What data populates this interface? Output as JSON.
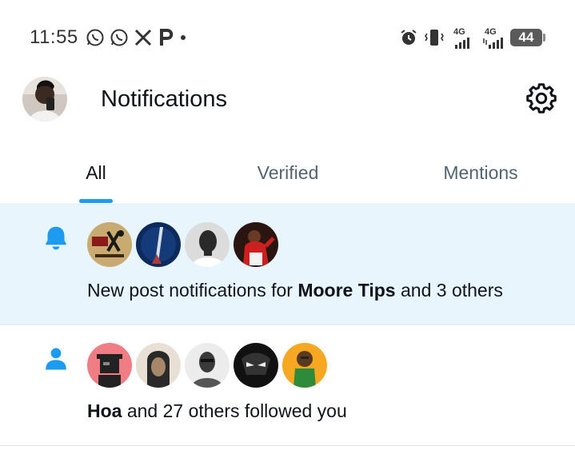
{
  "status_bar": {
    "time": "11:55",
    "battery": "44",
    "network_1": "4G",
    "network_2": "4G",
    "icons": [
      "whatsapp-icon",
      "whatsapp-icon",
      "x-icon",
      "p-icon",
      "alarm-icon",
      "vibrate-icon",
      "signal-icon",
      "signal-icon"
    ]
  },
  "header": {
    "title": "Notifications",
    "icons": [
      "avatar",
      "gear-icon"
    ]
  },
  "tabs": [
    {
      "label": "All",
      "active": true
    },
    {
      "label": "Verified",
      "active": false
    },
    {
      "label": "Mentions",
      "active": false
    }
  ],
  "notifications": [
    {
      "type_icon": "bell-icon",
      "text_pre": "New post notifications for ",
      "text_bold": "Moore Tips",
      "text_post": " and 3 others",
      "avatar_count": 4
    },
    {
      "type_icon": "person-icon",
      "text_pre": "",
      "text_bold": "Hoa",
      "text_post": " and 27 others followed you",
      "avatar_count": 5
    }
  ],
  "colors": {
    "accent": "#1d9bf0",
    "highlight_bg": "#e8f5fd",
    "text": "#0f1419",
    "secondary_text": "#536471"
  }
}
